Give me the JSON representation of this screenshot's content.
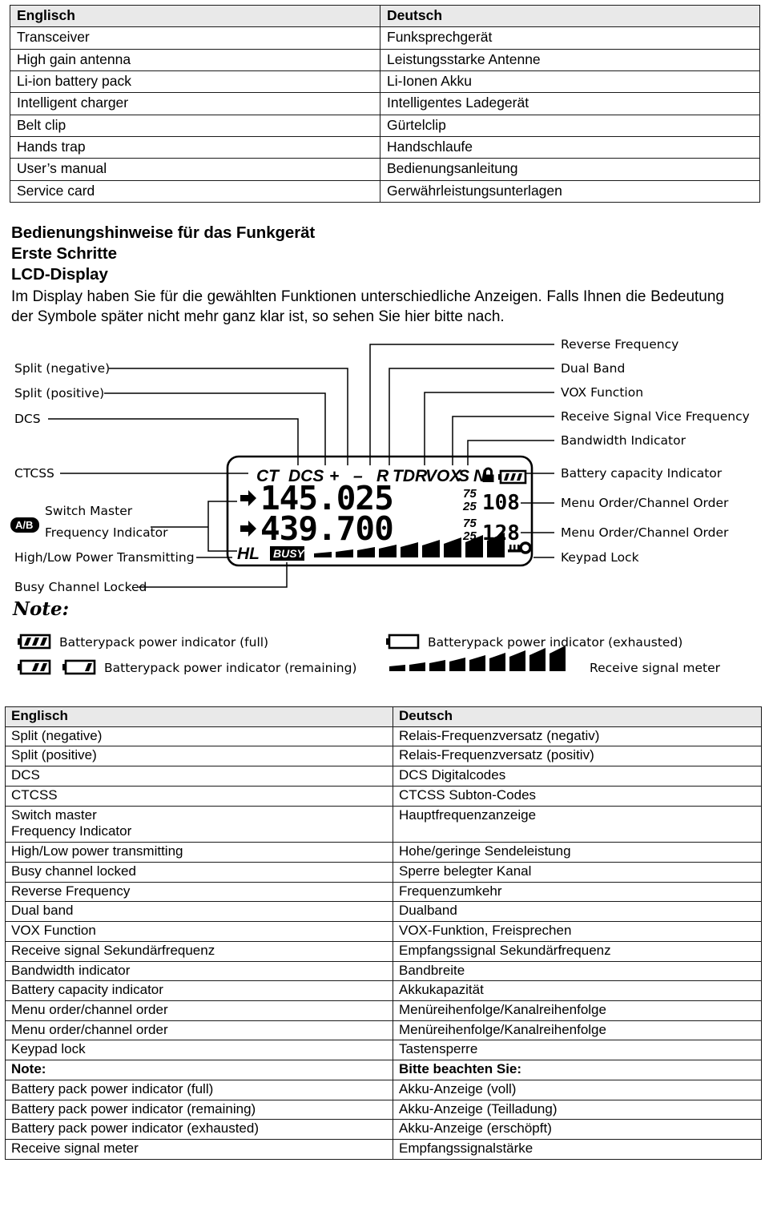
{
  "table_top": {
    "headers": [
      "Englisch",
      "Deutsch"
    ],
    "rows": [
      [
        "Transceiver",
        "Funksprechgerät"
      ],
      [
        "High gain antenna",
        "Leistungsstarke Antenne"
      ],
      [
        "Li-ion battery pack",
        "Li-Ionen Akku"
      ],
      [
        "Intelligent charger",
        "Intelligentes Ladegerät"
      ],
      [
        "Belt clip",
        "Gürtelclip"
      ],
      [
        "Hands trap",
        "Handschlaufe"
      ],
      [
        "User’s manual",
        "Bedienungsanleitung"
      ],
      [
        "Service card",
        "Gerwährleistungsunterlagen"
      ]
    ]
  },
  "headings": {
    "line1": "Bedienungshinweise für das Funkgerät",
    "line2": "Erste Schritte",
    "line3": "LCD-Display",
    "paragraph": "Im Display haben Sie für die gewählten Funktionen unterschiedliche Anzeigen. Falls Ihnen die Bedeutung der Symbole später nicht mehr ganz klar ist, so sehen Sie hier bitte nach."
  },
  "diagram": {
    "labels_left": [
      "Split (negative)",
      "Split (positive)",
      "DCS",
      "CTCSS",
      "Switch Master",
      "Frequency Indicator",
      "High/Low Power Transmitting",
      "Busy Channel Locked"
    ],
    "labels_right": [
      "Reverse Frequency",
      "Dual Band",
      "VOX Function",
      "Receive Signal Vice Frequency",
      "Bandwidth Indicator",
      "Battery capacity Indicator",
      "Menu Order/Channel Order",
      "Menu Order/Channel Order",
      "Keypad Lock"
    ],
    "ab_badge": "A/B",
    "lcd": {
      "status_row": [
        "CT",
        "DCS",
        "+",
        "–",
        "R",
        "TDR",
        "VOX",
        "S",
        "N"
      ],
      "freq_main": "145.025",
      "freq_sub": "439.700",
      "step_main_top": "75",
      "step_main_bottom": "25",
      "step_sub_top": "75",
      "step_sub_bottom": "25",
      "channel_main": "108",
      "channel_sub": "128",
      "power_mode": "HL",
      "busy_label": "BUSY",
      "signal_bars": 9,
      "lock_digit": "0"
    },
    "note": {
      "title": "Note:",
      "items": [
        "Batterypack power indicator (full)",
        "Batterypack power indicator (remaining)",
        "Batterypack power indicator (exhausted)",
        "Receive signal meter"
      ]
    }
  },
  "table_bottom": {
    "headers": [
      "Englisch",
      "Deutsch"
    ],
    "rows": [
      [
        "Split (negative)",
        "Relais-Frequenzversatz (negativ)",
        false
      ],
      [
        "Split (positive)",
        "Relais-Frequenzversatz (positiv)",
        false
      ],
      [
        "DCS",
        "DCS  Digitalcodes",
        false
      ],
      [
        "CTCSS",
        "CTCSS Subton-Codes",
        false
      ],
      [
        "Switch master\nFrequency Indicator",
        "Hauptfrequenzanzeige",
        false
      ],
      [
        "High/Low power transmitting",
        "Hohe/geringe Sendeleistung",
        false
      ],
      [
        "Busy channel locked",
        "Sperre belegter Kanal",
        false
      ],
      [
        "Reverse Frequency",
        "Frequenzumkehr",
        false
      ],
      [
        "Dual band",
        "Dualband",
        false
      ],
      [
        "VOX Function",
        "VOX-Funktion, Freisprechen",
        false
      ],
      [
        "Receive signal Sekundärfrequenz",
        "Empfangssignal Sekundärfrequenz",
        false
      ],
      [
        "Bandwidth indicator",
        "Bandbreite",
        false
      ],
      [
        "Battery capacity indicator",
        "Akkukapazität",
        false
      ],
      [
        "Menu order/channel order",
        "Menüreihenfolge/Kanalreihenfolge",
        false
      ],
      [
        "Menu order/channel order",
        "Menüreihenfolge/Kanalreihenfolge",
        false
      ],
      [
        "Keypad lock",
        "Tastensperre",
        false
      ],
      [
        "Note:",
        "Bitte beachten Sie:",
        true
      ],
      [
        "Battery pack power indicator (full)",
        "Akku-Anzeige (voll)",
        false
      ],
      [
        "Battery pack power indicator (remaining)",
        "Akku-Anzeige (Teilladung)",
        false
      ],
      [
        "Battery pack power indicator (exhausted)",
        "Akku-Anzeige (erschöpft)",
        false
      ],
      [
        "Receive signal meter",
        "Empfangssignalstärke",
        false
      ]
    ]
  },
  "colors": {
    "header_bg": "#e9e9e9",
    "border": "#1a1a1a",
    "text": "#000000"
  }
}
